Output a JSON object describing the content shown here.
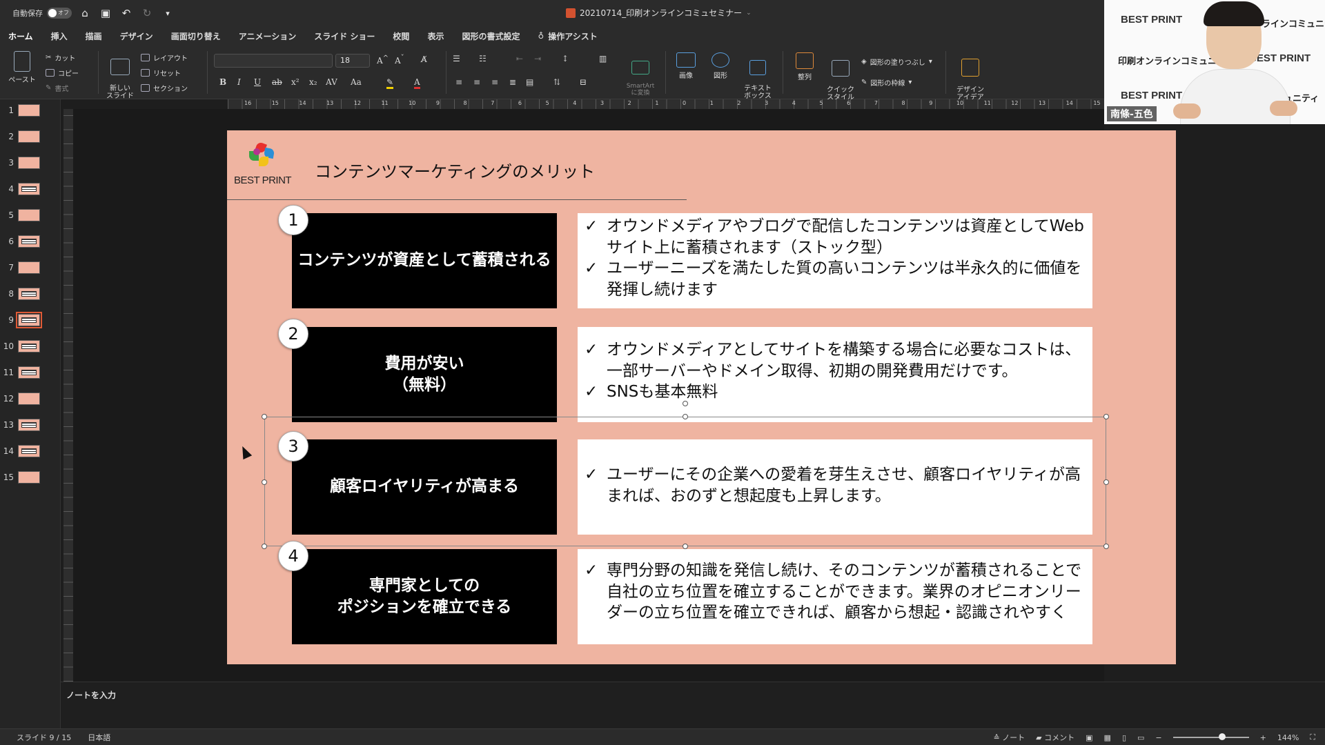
{
  "titlebar": {
    "autosave_label": "自動保存",
    "autosave_state": "オフ",
    "doc_title": "20210714_印刷オンラインコミュセミナー"
  },
  "tabs": [
    "ホーム",
    "挿入",
    "描画",
    "デザイン",
    "画面切り替え",
    "アニメーション",
    "スライド ショー",
    "校閲",
    "表示",
    "図形の書式設定"
  ],
  "tell_me": "操作アシスト",
  "ribbon": {
    "paste": "ペースト",
    "cut": "カット",
    "copy": "コピー",
    "format_painter": "書式",
    "new_slide": "新しい\nスライド",
    "layout": "レイアウト",
    "reset": "リセット",
    "section": "セクション",
    "font_size": "18",
    "smartart": "SmartArt\nに変換",
    "picture": "画像",
    "shapes": "図形",
    "textbox": "テキスト\nボックス",
    "arrange": "整列",
    "quick_styles": "クイック\nスタイル",
    "shape_fill": "図形の塗りつぶし",
    "shape_outline": "図形の枠線",
    "design_ideas": "デザイン\nアイデア"
  },
  "slides": {
    "count": 15,
    "selected": 9,
    "items": [
      1,
      2,
      3,
      4,
      5,
      6,
      7,
      8,
      9,
      10,
      11,
      12,
      13,
      14,
      15
    ]
  },
  "ruler": {
    "h_ticks": [
      "16",
      "15",
      "14",
      "13",
      "12",
      "11",
      "10",
      "9",
      "8",
      "7",
      "6",
      "5",
      "4",
      "3",
      "2",
      "1",
      "0",
      "1",
      "2",
      "3",
      "4",
      "5",
      "6",
      "7",
      "8",
      "9",
      "10",
      "11",
      "12",
      "13",
      "14",
      "15"
    ]
  },
  "slide": {
    "logo_text": "BEST PRINT",
    "title": "コンテンツマーケティングのメリット",
    "rows": [
      {
        "num": "1",
        "heading": "コンテンツが資産として蓄積される",
        "points": [
          "オウンドメディアやブログで配信したコンテンツは資産としてWebサイト上に蓄積されます（ストック型）",
          "ユーザーニーズを満たした質の高いコンテンツは半永久的に価値を発揮し続けます"
        ]
      },
      {
        "num": "2",
        "heading": "費用が安い\n（無料）",
        "points": [
          "オウンドメディアとしてサイトを構築する場合に必要なコストは、一部サーバーやドメイン取得、初期の開発費用だけです。",
          "SNSも基本無料"
        ]
      },
      {
        "num": "3",
        "heading": "顧客ロイヤリティが高まる",
        "points": [
          "ユーザーにその企業への愛着を芽生えさせ、顧客ロイヤリティが高まれば、おのずと想起度も上昇します。"
        ]
      },
      {
        "num": "4",
        "heading": "専門家としての\nポジションを確立できる",
        "points": [
          "専門分野の知識を発信し続け、そのコンテンツが蓄積されることで自社の立ち位置を確立することができます。業界のオピニオンリーダーの立ち位置を確立できれば、顧客から想起・認識されやすく"
        ]
      }
    ]
  },
  "notes_placeholder": "ノートを入力",
  "status": {
    "slide_position": "スライド 9 / 15",
    "language": "日本語",
    "notes_btn": "ノート",
    "comments_btn": "コメント",
    "zoom": "144%"
  },
  "video": {
    "banner1": "BEST PRINT",
    "banner2": "ラインコミュニティ",
    "banner3": "印刷オンラインコミュニティ",
    "banner4": "BEST PRINT",
    "banner5": "BEST PRINT",
    "banner6": "ュニティ",
    "name": "南條-五色"
  },
  "colors": {
    "slide_bg": "#efb4a1",
    "accent": "#e05a36",
    "box_dark": "#000000"
  }
}
